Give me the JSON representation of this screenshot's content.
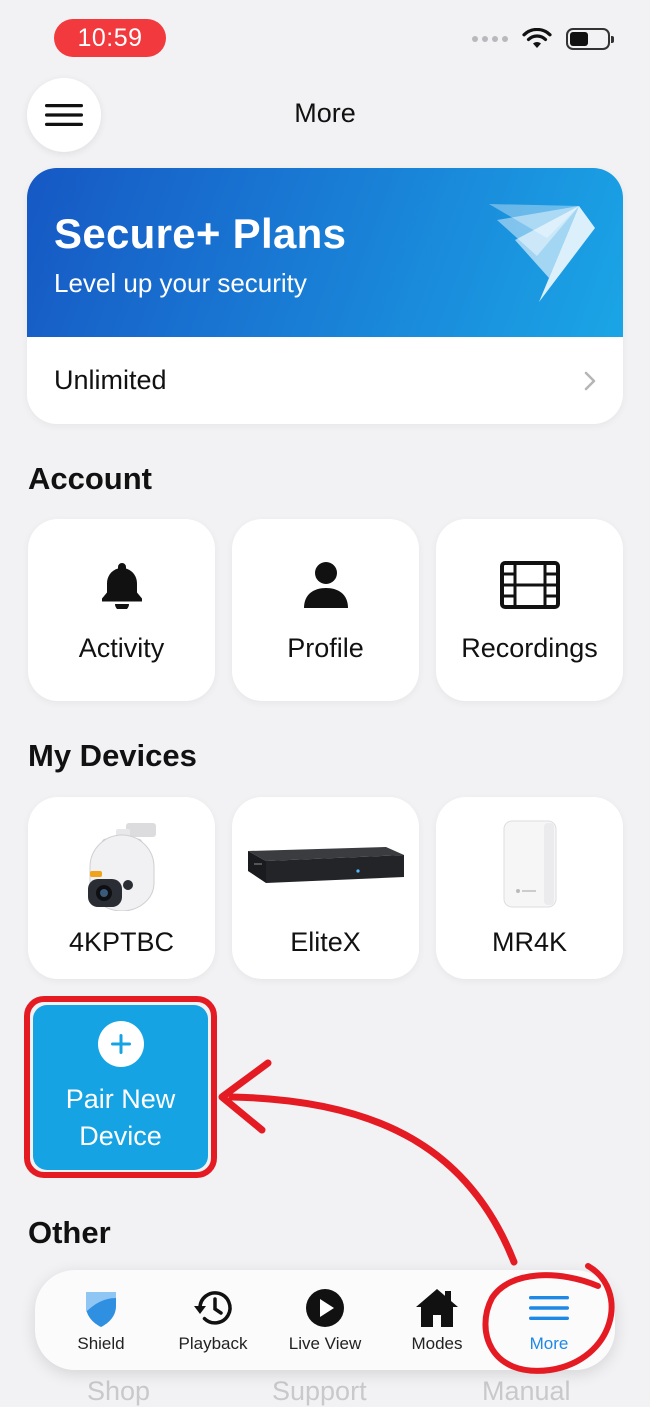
{
  "status_bar": {
    "time": "10:59"
  },
  "header": {
    "title": "More"
  },
  "promo": {
    "title": "Secure+ Plans",
    "subtitle": "Level up your security",
    "plan": "Unlimited"
  },
  "account": {
    "heading": "Account",
    "items": [
      {
        "label": "Activity",
        "icon": "bell-icon"
      },
      {
        "label": "Profile",
        "icon": "person-icon"
      },
      {
        "label": "Recordings",
        "icon": "film-icon"
      }
    ]
  },
  "devices": {
    "heading": "My Devices",
    "items": [
      {
        "label": "4KPTBC",
        "icon": "ptz-camera-image"
      },
      {
        "label": "EliteX",
        "icon": "nvr-recorder-image"
      },
      {
        "label": "MR4K",
        "icon": "router-image"
      }
    ],
    "pair_label": "Pair New Device"
  },
  "other": {
    "heading": "Other",
    "links": [
      "Shop",
      "Support",
      "Manual"
    ]
  },
  "tabbar": {
    "items": [
      {
        "label": "Shield",
        "icon": "shield-icon"
      },
      {
        "label": "Playback",
        "icon": "history-icon"
      },
      {
        "label": "Live View",
        "icon": "play-circle-icon"
      },
      {
        "label": "Modes",
        "icon": "home-icon"
      },
      {
        "label": "More",
        "icon": "menu-icon",
        "active": true
      }
    ]
  },
  "colors": {
    "accent": "#1e88e5",
    "pair_tile": "#15a3e3",
    "annotation": "#e51b24",
    "status_pill": "#f2393e"
  }
}
